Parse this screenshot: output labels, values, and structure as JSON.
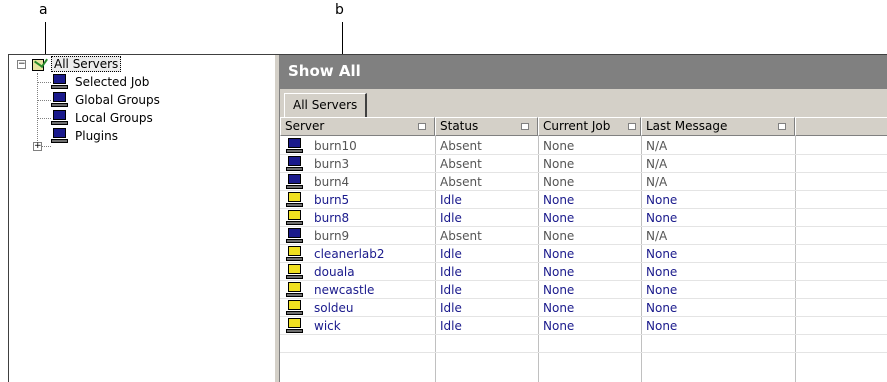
{
  "callouts": [
    {
      "label": "a"
    },
    {
      "label": "b"
    }
  ],
  "tree": {
    "root": {
      "label": "All Servers",
      "expander": "−",
      "icon": "all-servers-icon"
    },
    "children": [
      {
        "label": "Selected Job",
        "icon": "computer-icon"
      },
      {
        "label": "Global Groups",
        "icon": "computer-icon"
      },
      {
        "label": "Local Groups",
        "icon": "computer-icon"
      },
      {
        "label": "Plugins",
        "icon": "computer-icon",
        "expander": "+"
      }
    ]
  },
  "panel": {
    "title": "Show All",
    "tab": "All Servers"
  },
  "table": {
    "columns": [
      "Server",
      "Status",
      "Current Job",
      "Last Message"
    ],
    "rows": [
      {
        "server": "burn10",
        "status": "Absent",
        "job": "None",
        "message": "N/A",
        "state": "absent"
      },
      {
        "server": "burn3",
        "status": "Absent",
        "job": "None",
        "message": "N/A",
        "state": "absent"
      },
      {
        "server": "burn4",
        "status": "Absent",
        "job": "None",
        "message": "N/A",
        "state": "absent"
      },
      {
        "server": "burn5",
        "status": "Idle",
        "job": "None",
        "message": "None",
        "state": "idle"
      },
      {
        "server": "burn8",
        "status": "Idle",
        "job": "None",
        "message": "None",
        "state": "idle"
      },
      {
        "server": "burn9",
        "status": "Absent",
        "job": "None",
        "message": "N/A",
        "state": "absent"
      },
      {
        "server": "cleanerlab2",
        "status": "Idle",
        "job": "None",
        "message": "None",
        "state": "idle"
      },
      {
        "server": "douala",
        "status": "Idle",
        "job": "None",
        "message": "None",
        "state": "idle"
      },
      {
        "server": "newcastle",
        "status": "Idle",
        "job": "None",
        "message": "None",
        "state": "idle"
      },
      {
        "server": "soldeu",
        "status": "Idle",
        "job": "None",
        "message": "None",
        "state": "idle"
      },
      {
        "server": "wick",
        "status": "Idle",
        "job": "None",
        "message": "None",
        "state": "idle"
      }
    ]
  },
  "colors": {
    "absent_text": "#555555",
    "idle_text": "#1a1a8c",
    "absent_icon": "#1a1a8c",
    "idle_icon": "#f0e020",
    "header_bar": "#808080"
  }
}
